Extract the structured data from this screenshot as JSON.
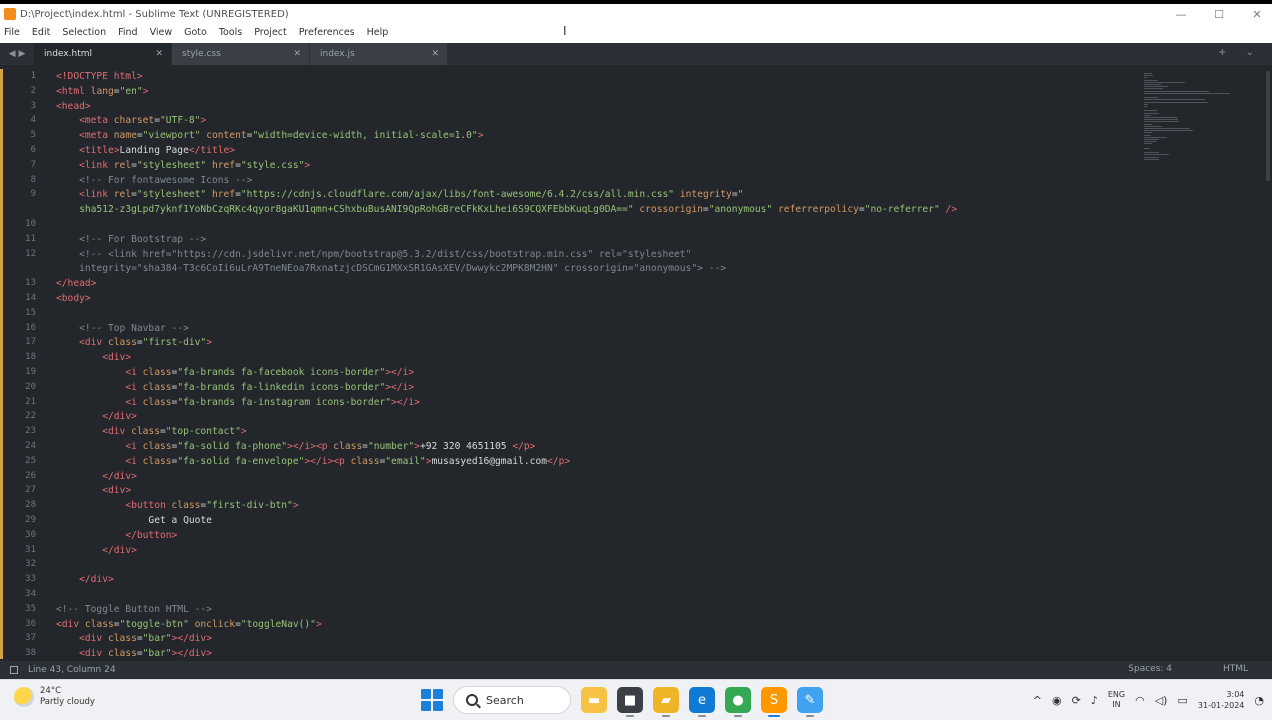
{
  "window": {
    "title": "D:\\Project\\index.html - Sublime Text (UNREGISTERED)",
    "controls": {
      "minimize": "—",
      "maximize": "☐",
      "close": "✕"
    }
  },
  "menu": [
    "File",
    "Edit",
    "Selection",
    "Find",
    "View",
    "Goto",
    "Tools",
    "Project",
    "Preferences",
    "Help"
  ],
  "tabs": [
    {
      "label": "index.html",
      "active": true
    },
    {
      "label": "style.css",
      "active": false
    },
    {
      "label": "index.js",
      "active": false
    }
  ],
  "tab_nav": {
    "left": "◀",
    "right": "▶",
    "extra": "+ ⌄"
  },
  "code_lines": [
    {
      "n": "1",
      "segs": [
        [
          "tag",
          "<!DOCTYPE html>"
        ]
      ]
    },
    {
      "n": "2",
      "segs": [
        [
          "tag",
          "<html"
        ],
        [
          "attr",
          " lang"
        ],
        [
          "punct",
          "="
        ],
        [
          "str",
          "\"en\""
        ],
        [
          "tag",
          ">"
        ]
      ]
    },
    {
      "n": "3",
      "segs": [
        [
          "tag",
          "<head>"
        ]
      ]
    },
    {
      "n": "4",
      "segs": [
        [
          "txt",
          "    "
        ],
        [
          "tag",
          "<meta"
        ],
        [
          "attr",
          " charset"
        ],
        [
          "punct",
          "="
        ],
        [
          "str",
          "\"UTF-8\""
        ],
        [
          "tag",
          ">"
        ]
      ]
    },
    {
      "n": "5",
      "segs": [
        [
          "txt",
          "    "
        ],
        [
          "tag",
          "<meta"
        ],
        [
          "attr",
          " name"
        ],
        [
          "punct",
          "="
        ],
        [
          "str",
          "\"viewport\""
        ],
        [
          "attr",
          " content"
        ],
        [
          "punct",
          "="
        ],
        [
          "str",
          "\"width=device-width, initial-scale=1.0\""
        ],
        [
          "tag",
          ">"
        ]
      ]
    },
    {
      "n": "6",
      "segs": [
        [
          "txt",
          "    "
        ],
        [
          "tag",
          "<title>"
        ],
        [
          "txt",
          "Landing Page"
        ],
        [
          "tag",
          "</title>"
        ]
      ]
    },
    {
      "n": "7",
      "segs": [
        [
          "txt",
          "    "
        ],
        [
          "tag",
          "<link"
        ],
        [
          "attr",
          " rel"
        ],
        [
          "punct",
          "="
        ],
        [
          "str",
          "\"stylesheet\""
        ],
        [
          "attr",
          " href"
        ],
        [
          "punct",
          "="
        ],
        [
          "str",
          "\"style.css\""
        ],
        [
          "tag",
          ">"
        ]
      ]
    },
    {
      "n": "8",
      "segs": [
        [
          "txt",
          "    "
        ],
        [
          "cm",
          "<!-- For fontawesome Icons -->"
        ]
      ]
    },
    {
      "n": "9",
      "segs": [
        [
          "txt",
          "    "
        ],
        [
          "tag",
          "<link"
        ],
        [
          "attr",
          " rel"
        ],
        [
          "punct",
          "="
        ],
        [
          "str",
          "\"stylesheet\""
        ],
        [
          "attr",
          " href"
        ],
        [
          "punct",
          "="
        ],
        [
          "str",
          "\"https://cdnjs.cloudflare.com/ajax/libs/font-awesome/6.4.2/css/all.min.css\""
        ],
        [
          "attr",
          " integrity"
        ],
        [
          "punct",
          "="
        ],
        [
          "str",
          "\""
        ]
      ]
    },
    {
      "n": "",
      "segs": [
        [
          "txt",
          "    "
        ],
        [
          "str",
          "sha512-z3gLpd7yknf1YoNbCzqRKc4qyor8gaKU1qmn+CShxbuBusANI9QpRohGBreCFkKxLhei6S9CQXFEbbKuqLg0DA==\""
        ],
        [
          "attr",
          " crossorigin"
        ],
        [
          "punct",
          "="
        ],
        [
          "str",
          "\"anonymous\""
        ],
        [
          "attr",
          " referrerpolicy"
        ],
        [
          "punct",
          "="
        ],
        [
          "str",
          "\"no-referrer\""
        ],
        [
          "tag",
          " />"
        ]
      ]
    },
    {
      "n": "10",
      "segs": []
    },
    {
      "n": "11",
      "segs": [
        [
          "txt",
          "    "
        ],
        [
          "cm",
          "<!-- For Bootstrap -->"
        ]
      ]
    },
    {
      "n": "12",
      "segs": [
        [
          "txt",
          "    "
        ],
        [
          "cm",
          "<!-- <link href=\"https://cdn.jsdelivr.net/npm/bootstrap@5.3.2/dist/css/bootstrap.min.css\" rel=\"stylesheet\""
        ]
      ]
    },
    {
      "n": "",
      "segs": [
        [
          "txt",
          "    "
        ],
        [
          "cm",
          "integrity=\"sha384-T3c6CoIi6uLrA9TneNEoa7RxnatzjcDSCmG1MXxSR1GAsXEV/Dwwykc2MPK8M2HN\" crossorigin=\"anonymous\"> -->"
        ]
      ]
    },
    {
      "n": "13",
      "segs": [
        [
          "tag",
          "</head>"
        ]
      ]
    },
    {
      "n": "14",
      "segs": [
        [
          "tag",
          "<body>"
        ]
      ]
    },
    {
      "n": "15",
      "segs": []
    },
    {
      "n": "16",
      "segs": [
        [
          "txt",
          "    "
        ],
        [
          "cm",
          "<!-- Top Navbar -->"
        ]
      ]
    },
    {
      "n": "17",
      "segs": [
        [
          "txt",
          "    "
        ],
        [
          "tag",
          "<div"
        ],
        [
          "attr",
          " class"
        ],
        [
          "punct",
          "="
        ],
        [
          "str",
          "\"first-div\""
        ],
        [
          "tag",
          ">"
        ]
      ]
    },
    {
      "n": "18",
      "segs": [
        [
          "txt",
          "        "
        ],
        [
          "tag",
          "<div>"
        ]
      ]
    },
    {
      "n": "19",
      "segs": [
        [
          "txt",
          "            "
        ],
        [
          "tag",
          "<i"
        ],
        [
          "attr",
          " class"
        ],
        [
          "punct",
          "="
        ],
        [
          "str",
          "\"fa-brands fa-facebook icons-border\""
        ],
        [
          "tag",
          "></i>"
        ]
      ]
    },
    {
      "n": "20",
      "segs": [
        [
          "txt",
          "            "
        ],
        [
          "tag",
          "<i"
        ],
        [
          "attr",
          " class"
        ],
        [
          "punct",
          "="
        ],
        [
          "str",
          "\"fa-brands fa-linkedin icons-border\""
        ],
        [
          "tag",
          "></i>"
        ]
      ]
    },
    {
      "n": "21",
      "segs": [
        [
          "txt",
          "            "
        ],
        [
          "tag",
          "<i"
        ],
        [
          "attr",
          " class"
        ],
        [
          "punct",
          "="
        ],
        [
          "str",
          "\"fa-brands fa-instagram icons-border\""
        ],
        [
          "tag",
          "></i>"
        ]
      ]
    },
    {
      "n": "22",
      "segs": [
        [
          "txt",
          "        "
        ],
        [
          "tag",
          "</div>"
        ]
      ]
    },
    {
      "n": "23",
      "segs": [
        [
          "txt",
          "        "
        ],
        [
          "tag",
          "<div"
        ],
        [
          "attr",
          " class"
        ],
        [
          "punct",
          "="
        ],
        [
          "str",
          "\"top-contact\""
        ],
        [
          "tag",
          ">"
        ]
      ]
    },
    {
      "n": "24",
      "segs": [
        [
          "txt",
          "            "
        ],
        [
          "tag",
          "<i"
        ],
        [
          "attr",
          " class"
        ],
        [
          "punct",
          "="
        ],
        [
          "str",
          "\"fa-solid fa-phone\""
        ],
        [
          "tag",
          "></i><p"
        ],
        [
          "attr",
          " class"
        ],
        [
          "punct",
          "="
        ],
        [
          "str",
          "\"number\""
        ],
        [
          "tag",
          ">"
        ],
        [
          "txt",
          "+92 320 4651105 "
        ],
        [
          "tag",
          "</p>"
        ]
      ]
    },
    {
      "n": "25",
      "segs": [
        [
          "txt",
          "            "
        ],
        [
          "tag",
          "<i"
        ],
        [
          "attr",
          " class"
        ],
        [
          "punct",
          "="
        ],
        [
          "str",
          "\"fa-solid fa-envelope\""
        ],
        [
          "tag",
          "></i><p"
        ],
        [
          "attr",
          " class"
        ],
        [
          "punct",
          "="
        ],
        [
          "str",
          "\"email\""
        ],
        [
          "tag",
          ">"
        ],
        [
          "txt",
          "musasyed16@gmail.com"
        ],
        [
          "tag",
          "</p>"
        ]
      ]
    },
    {
      "n": "26",
      "segs": [
        [
          "txt",
          "        "
        ],
        [
          "tag",
          "</div>"
        ]
      ]
    },
    {
      "n": "27",
      "segs": [
        [
          "txt",
          "        "
        ],
        [
          "tag",
          "<div>"
        ]
      ]
    },
    {
      "n": "28",
      "segs": [
        [
          "txt",
          "            "
        ],
        [
          "tag",
          "<button"
        ],
        [
          "attr",
          " class"
        ],
        [
          "punct",
          "="
        ],
        [
          "str",
          "\"first-div-btn\""
        ],
        [
          "tag",
          ">"
        ]
      ]
    },
    {
      "n": "29",
      "segs": [
        [
          "txt",
          "                Get a Quote"
        ]
      ]
    },
    {
      "n": "30",
      "segs": [
        [
          "txt",
          "            "
        ],
        [
          "tag",
          "</button>"
        ]
      ]
    },
    {
      "n": "31",
      "segs": [
        [
          "txt",
          "        "
        ],
        [
          "tag",
          "</div>"
        ]
      ]
    },
    {
      "n": "32",
      "segs": []
    },
    {
      "n": "33",
      "segs": [
        [
          "txt",
          "    "
        ],
        [
          "tag",
          "</div>"
        ]
      ]
    },
    {
      "n": "34",
      "segs": []
    },
    {
      "n": "35",
      "segs": [
        [
          "cm",
          "<!-- Toggle Button HTML -->"
        ]
      ]
    },
    {
      "n": "36",
      "segs": [
        [
          "tag",
          "<div"
        ],
        [
          "attr",
          " class"
        ],
        [
          "punct",
          "="
        ],
        [
          "str",
          "\"toggle-btn\""
        ],
        [
          "attr",
          " onclick"
        ],
        [
          "punct",
          "="
        ],
        [
          "str",
          "\"toggleNav()\""
        ],
        [
          "tag",
          ">"
        ]
      ]
    },
    {
      "n": "37",
      "segs": [
        [
          "txt",
          "    "
        ],
        [
          "tag",
          "<div"
        ],
        [
          "attr",
          " class"
        ],
        [
          "punct",
          "="
        ],
        [
          "str",
          "\"bar\""
        ],
        [
          "tag",
          "></div>"
        ]
      ]
    },
    {
      "n": "38",
      "segs": [
        [
          "txt",
          "    "
        ],
        [
          "tag",
          "<div"
        ],
        [
          "attr",
          " class"
        ],
        [
          "punct",
          "="
        ],
        [
          "str",
          "\"bar\""
        ],
        [
          "tag",
          "></div>"
        ]
      ]
    }
  ],
  "statusbar": {
    "position": "Line 43, Column 24",
    "indent": "Spaces: 4",
    "syntax": "HTML"
  },
  "taskbar": {
    "weather": {
      "temp": "24°C",
      "condition": "Partly cloudy"
    },
    "search_label": "Search",
    "apps": [
      {
        "name": "file-explorer",
        "glyph": "▬",
        "color": "#f6c344"
      },
      {
        "name": "files",
        "glyph": "■",
        "color": "#3b3f46"
      },
      {
        "name": "folder",
        "glyph": "▰",
        "color": "#f0b429"
      },
      {
        "name": "edge",
        "glyph": "e",
        "color": "#0f7bd6"
      },
      {
        "name": "chrome",
        "glyph": "●",
        "color": "#34a853"
      },
      {
        "name": "sublime",
        "glyph": "S",
        "color": "#ff9800"
      },
      {
        "name": "paint",
        "glyph": "✎",
        "color": "#3fa3f1"
      }
    ],
    "tray": {
      "chevron": "^",
      "lang_top": "ENG",
      "lang_bottom": "IN",
      "time": "3:04",
      "date": "31-01-2024"
    }
  }
}
